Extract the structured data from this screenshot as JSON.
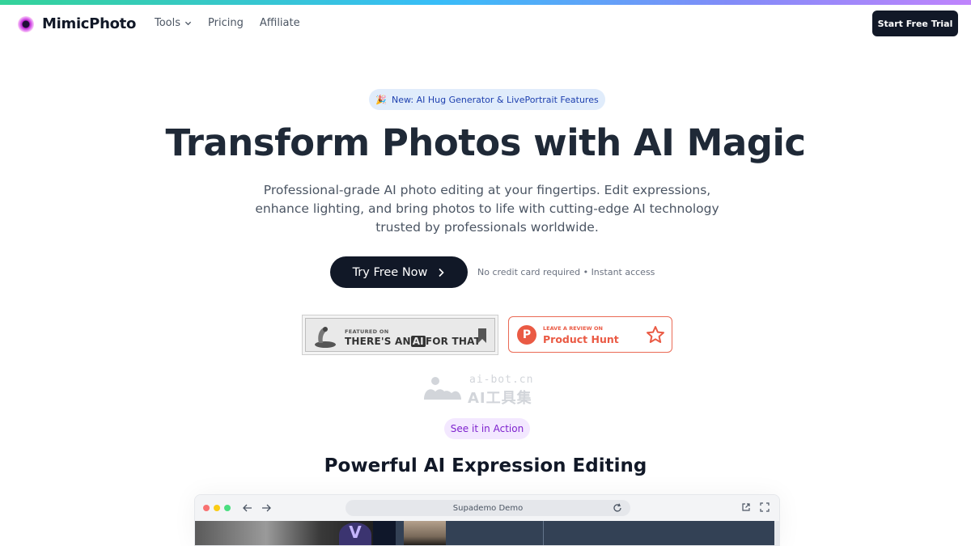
{
  "brand": {
    "name": "MimicPhoto"
  },
  "nav": {
    "links": [
      {
        "label": "Tools",
        "has_dropdown": true
      },
      {
        "label": "Pricing"
      },
      {
        "label": "Affiliate"
      }
    ],
    "cta_label": "Start Free Trial"
  },
  "announcement": {
    "icon": "party-popper-icon",
    "emoji": "🎉",
    "text": "New: AI Hug Generator & LivePortrait Features"
  },
  "hero": {
    "title": "Transform Photos with AI Magic",
    "subtitle": "Professional-grade AI photo editing at your fingertips. Edit expressions, enhance lighting, and bring photos to life with cutting-edge AI technology trusted by professionals worldwide.",
    "cta_label": "Try Free Now",
    "cta_note": "No credit card required • Instant access"
  },
  "badges": {
    "taaft": {
      "small": "FEATURED ON",
      "big_prefix": "THERE'S AN",
      "big_ai": "AI",
      "big_suffix": "FOR THAT"
    },
    "producthunt": {
      "small": "LEAVE A REVIEW ON",
      "big": "Product Hunt",
      "letter": "P"
    }
  },
  "watermark": {
    "top": "ai-bot.cn",
    "bottom": "AI工具集"
  },
  "demo": {
    "pill": "See it in Action",
    "title": "Powerful AI Expression Editing",
    "browser_url": "Supademo Demo",
    "content_letter": "V"
  },
  "colors": {
    "primary_dark": "#111827",
    "announcement_bg": "#e0ecfb",
    "announcement_text": "#1e40af",
    "pill_bg": "#f3e8ff",
    "pill_text": "#7e22ce",
    "producthunt": "#ea5a44"
  }
}
